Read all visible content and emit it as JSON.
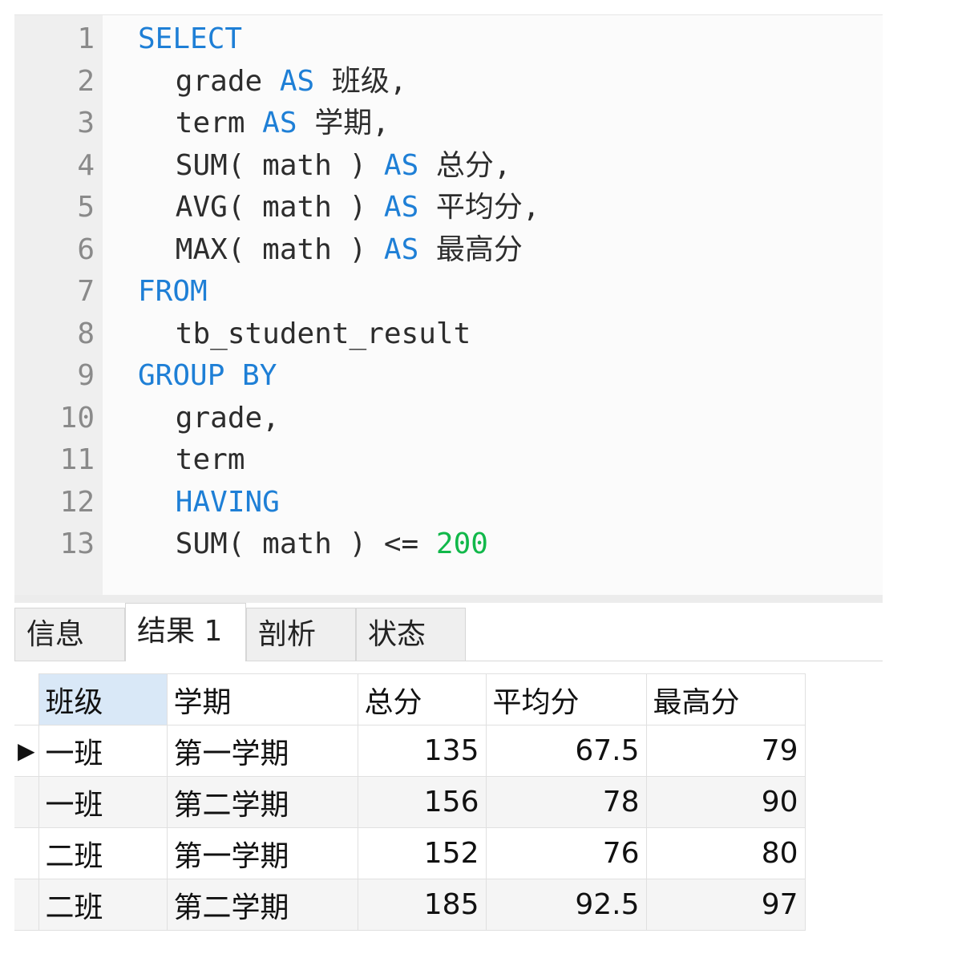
{
  "editor": {
    "lines": [
      {
        "n": "1",
        "tokens": [
          {
            "t": "SELECT",
            "c": "kw",
            "indent": 0
          }
        ]
      },
      {
        "n": "2",
        "tokens": [
          {
            "t": "grade ",
            "c": "id",
            "indent": 2
          },
          {
            "t": "AS",
            "c": "kw"
          },
          {
            "t": " 班级,",
            "c": "id"
          }
        ]
      },
      {
        "n": "3",
        "tokens": [
          {
            "t": "term ",
            "c": "id",
            "indent": 2
          },
          {
            "t": "AS",
            "c": "kw"
          },
          {
            "t": " 学期,",
            "c": "id"
          }
        ]
      },
      {
        "n": "4",
        "tokens": [
          {
            "t": "SUM( math ) ",
            "c": "id",
            "indent": 2
          },
          {
            "t": "AS",
            "c": "kw"
          },
          {
            "t": " 总分,",
            "c": "id"
          }
        ]
      },
      {
        "n": "5",
        "tokens": [
          {
            "t": "AVG( math ) ",
            "c": "id",
            "indent": 2
          },
          {
            "t": "AS",
            "c": "kw"
          },
          {
            "t": " 平均分,",
            "c": "id"
          }
        ]
      },
      {
        "n": "6",
        "tokens": [
          {
            "t": "MAX( math ) ",
            "c": "id",
            "indent": 2
          },
          {
            "t": "AS",
            "c": "kw"
          },
          {
            "t": " 最高分",
            "c": "id"
          }
        ]
      },
      {
        "n": "7",
        "tokens": [
          {
            "t": "FROM",
            "c": "kw",
            "indent": 0
          }
        ]
      },
      {
        "n": "8",
        "tokens": [
          {
            "t": "tb_student_result",
            "c": "id",
            "indent": 2
          }
        ]
      },
      {
        "n": "9",
        "tokens": [
          {
            "t": "GROUP BY",
            "c": "kw",
            "indent": 0
          }
        ]
      },
      {
        "n": "10",
        "tokens": [
          {
            "t": "grade,",
            "c": "id",
            "indent": 2
          }
        ]
      },
      {
        "n": "11",
        "tokens": [
          {
            "t": "term",
            "c": "id",
            "indent": 2
          }
        ]
      },
      {
        "n": "12",
        "tokens": [
          {
            "t": "HAVING",
            "c": "kw",
            "indent": 2
          }
        ]
      },
      {
        "n": "13",
        "tokens": [
          {
            "t": "SUM( math ) <= ",
            "c": "id",
            "indent": 2
          },
          {
            "t": "200",
            "c": "num"
          }
        ]
      }
    ]
  },
  "tabs": [
    {
      "label": "信息",
      "active": false
    },
    {
      "label": "结果 1",
      "active": true
    },
    {
      "label": "剖析",
      "active": false
    },
    {
      "label": "状态",
      "active": false
    }
  ],
  "result": {
    "columns": [
      "班级",
      "学期",
      "总分",
      "平均分",
      "最高分"
    ],
    "selected_column": 0,
    "current_row": 0,
    "rows": [
      [
        "一班",
        "第一学期",
        "135",
        "67.5",
        "79"
      ],
      [
        "一班",
        "第二学期",
        "156",
        "78",
        "90"
      ],
      [
        "二班",
        "第一学期",
        "152",
        "76",
        "80"
      ],
      [
        "二班",
        "第二学期",
        "185",
        "92.5",
        "97"
      ]
    ]
  },
  "colors": {
    "keyword": "#1e7fd6",
    "number": "#11b84a",
    "text": "#2d2d2d",
    "line_number": "#8a8a8a"
  }
}
